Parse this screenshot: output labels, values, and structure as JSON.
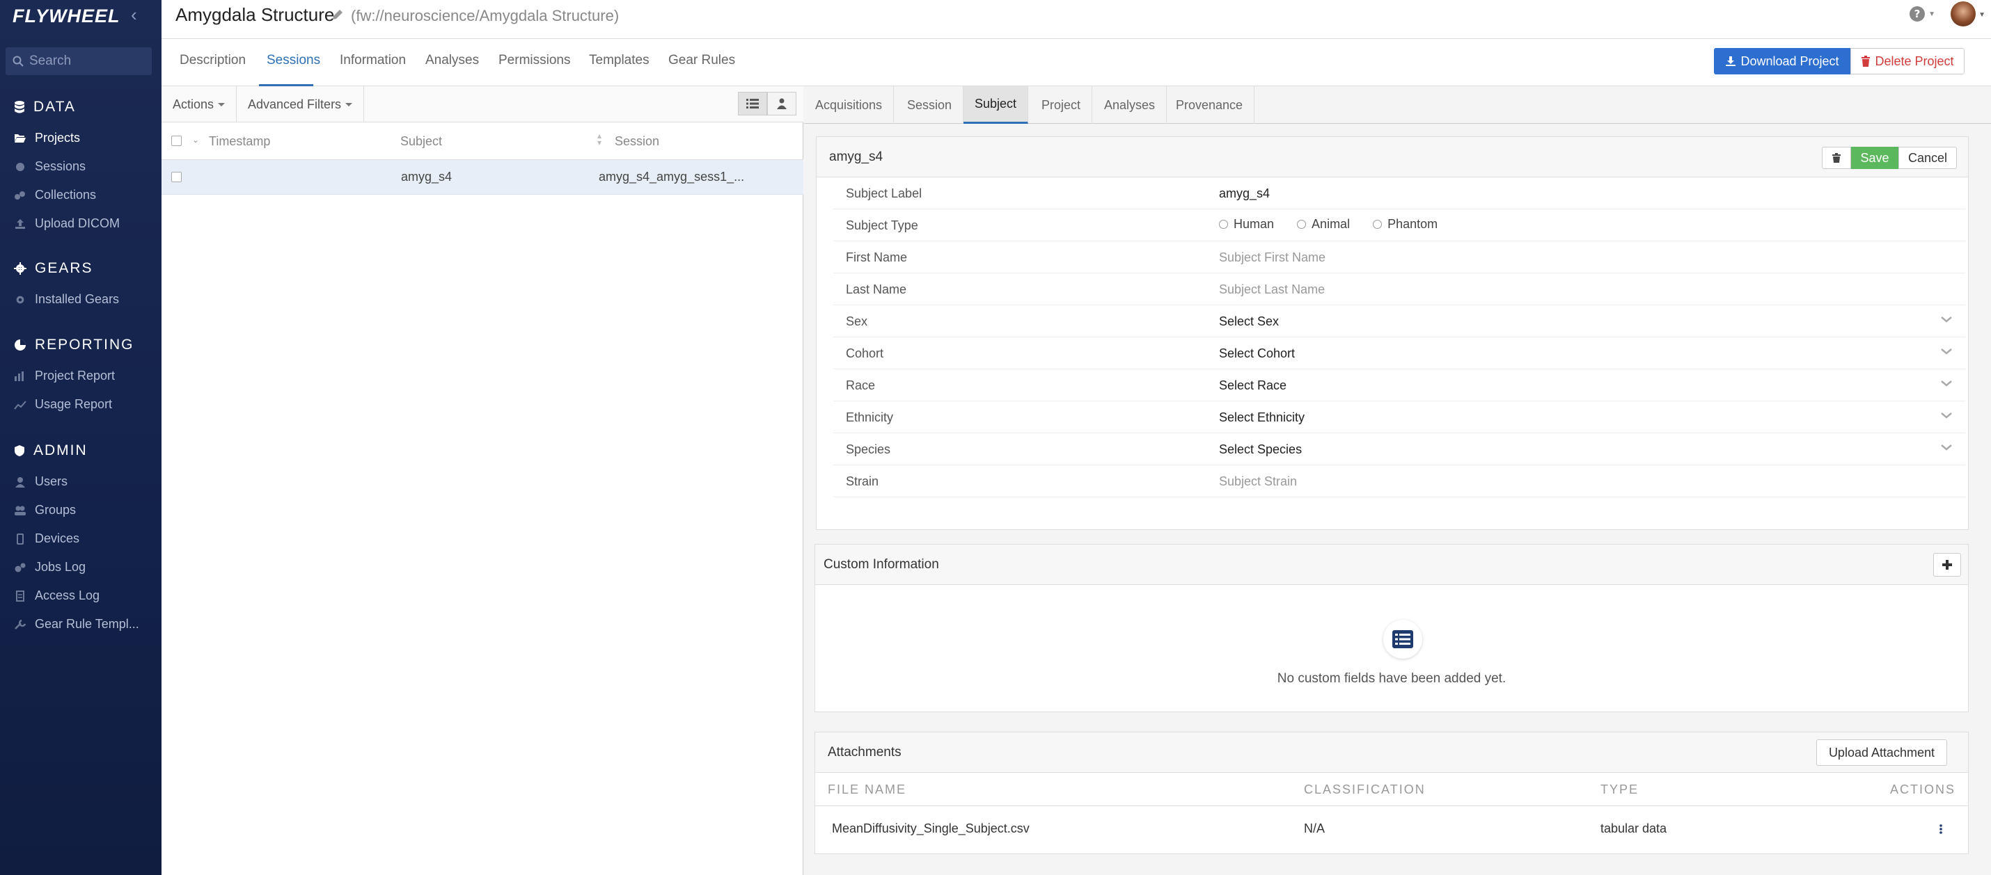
{
  "sidebar": {
    "logo": "FLYWHEEL",
    "search_placeholder": "Search",
    "sections": [
      {
        "title": "DATA",
        "items": [
          "Projects",
          "Sessions",
          "Collections",
          "Upload DICOM"
        ]
      },
      {
        "title": "GEARS",
        "items": [
          "Installed Gears"
        ]
      },
      {
        "title": "REPORTING",
        "items": [
          "Project Report",
          "Usage Report"
        ]
      },
      {
        "title": "ADMIN",
        "items": [
          "Users",
          "Groups",
          "Devices",
          "Jobs Log",
          "Access Log",
          "Gear Rule Templ..."
        ]
      }
    ]
  },
  "header": {
    "title": "Amygdala Structure",
    "path": "(fw://neuroscience/Amygdala Structure)"
  },
  "project_tabs": [
    "Description",
    "Sessions",
    "Information",
    "Analyses",
    "Permissions",
    "Templates",
    "Gear Rules"
  ],
  "actions": {
    "download": "Download Project",
    "delete": "Delete Project"
  },
  "left": {
    "toolbar": {
      "actions": "Actions",
      "filters": "Advanced Filters"
    },
    "columns": [
      "Timestamp",
      "Subject",
      "Session"
    ],
    "rows": [
      {
        "timestamp": "",
        "subject": "amyg_s4",
        "session": "amyg_s4_amyg_sess1_..."
      }
    ]
  },
  "right_tabs": [
    "Acquisitions",
    "Session",
    "Subject",
    "Project",
    "Analyses",
    "Provenance"
  ],
  "subject_form": {
    "title": "amyg_s4",
    "save": "Save",
    "cancel": "Cancel",
    "fields": {
      "label": {
        "label": "Subject Label",
        "value": "amyg_s4"
      },
      "type": {
        "label": "Subject Type",
        "options": [
          "Human",
          "Animal",
          "Phantom"
        ]
      },
      "first": {
        "label": "First Name",
        "placeholder": "Subject First Name"
      },
      "last": {
        "label": "Last Name",
        "placeholder": "Subject Last Name"
      },
      "sex": {
        "label": "Sex",
        "value": "Select Sex"
      },
      "cohort": {
        "label": "Cohort",
        "value": "Select Cohort"
      },
      "race": {
        "label": "Race",
        "value": "Select Race"
      },
      "ethnicity": {
        "label": "Ethnicity",
        "value": "Select Ethnicity"
      },
      "species": {
        "label": "Species",
        "value": "Select Species"
      },
      "strain": {
        "label": "Strain",
        "placeholder": "Subject Strain"
      }
    }
  },
  "custom": {
    "title": "Custom Information",
    "empty": "No custom fields have been added yet."
  },
  "attachments": {
    "title": "Attachments",
    "upload": "Upload Attachment",
    "columns": [
      "FILE NAME",
      "CLASSIFICATION",
      "TYPE",
      "ACTIONS"
    ],
    "rows": [
      {
        "name": "MeanDiffusivity_Single_Subject.csv",
        "classification": "N/A",
        "type": "tabular data"
      }
    ]
  },
  "colors": {
    "accent": "#2f6fb6",
    "primary_button": "#2c6fd0",
    "save_button": "#5cb85c",
    "danger": "#d23b3b",
    "sidebar": "#13224a"
  }
}
